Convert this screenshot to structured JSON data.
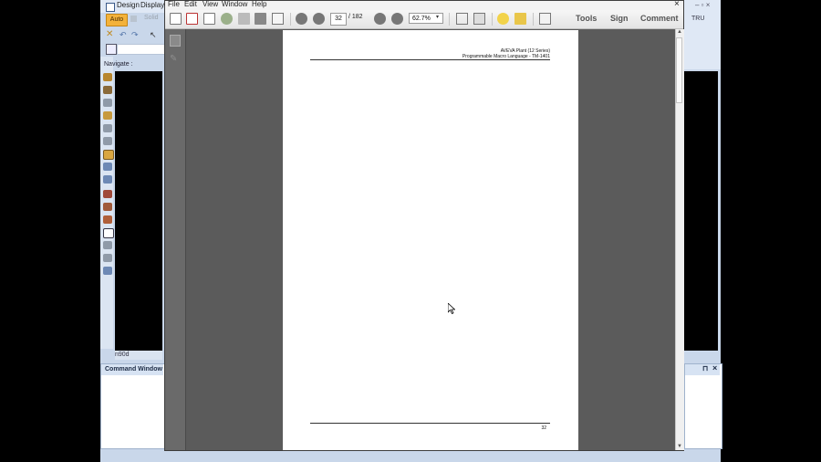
{
  "cad": {
    "menu": [
      "Design",
      "Display"
    ],
    "auto_label": "Auto",
    "solid_label": "Solid",
    "navigate_label": "Navigate :",
    "view_label": "n90d",
    "tru_label": "TRU",
    "command_window_title": "Command Window",
    "pin_symbol": "⊓",
    "close_symbol": "×",
    "window_buttons": "– ▫ ×"
  },
  "pdf": {
    "menu": [
      "File",
      "Edit",
      "View",
      "Window",
      "Help"
    ],
    "close_symbol": "×",
    "current_page": "32",
    "total_pages": "/ 182",
    "zoom": "62.7%",
    "zoom_arrow": "▾",
    "tools_label": "Tools",
    "sign_label": "Sign",
    "comment_label": "Comment",
    "page": {
      "header_line1": "AVEVA Plant (12 Series)",
      "header_line2": "Programmable Macro Language - TM-1401",
      "footer_page_number": "32"
    }
  },
  "colors": {
    "accent_orange": "#f3b23b",
    "cad_blue": "#c9d7ea",
    "viewer_gray": "#5b5b5b"
  },
  "icons": [
    "cad-app-icon",
    "undo-icon",
    "redo-icon",
    "pointer-icon",
    "create-pdf-icon",
    "open-icon",
    "edit-icon",
    "cloud-icon",
    "save-icon",
    "print-icon",
    "email-icon",
    "prev-page-icon",
    "next-page-icon",
    "zoom-out-icon",
    "zoom-in-icon",
    "fit-page-icon",
    "full-screen-icon",
    "comment-bubble-icon",
    "highlight-icon",
    "share-icon",
    "pages-panel-icon",
    "attachments-icon",
    "mouse-cursor-icon"
  ]
}
